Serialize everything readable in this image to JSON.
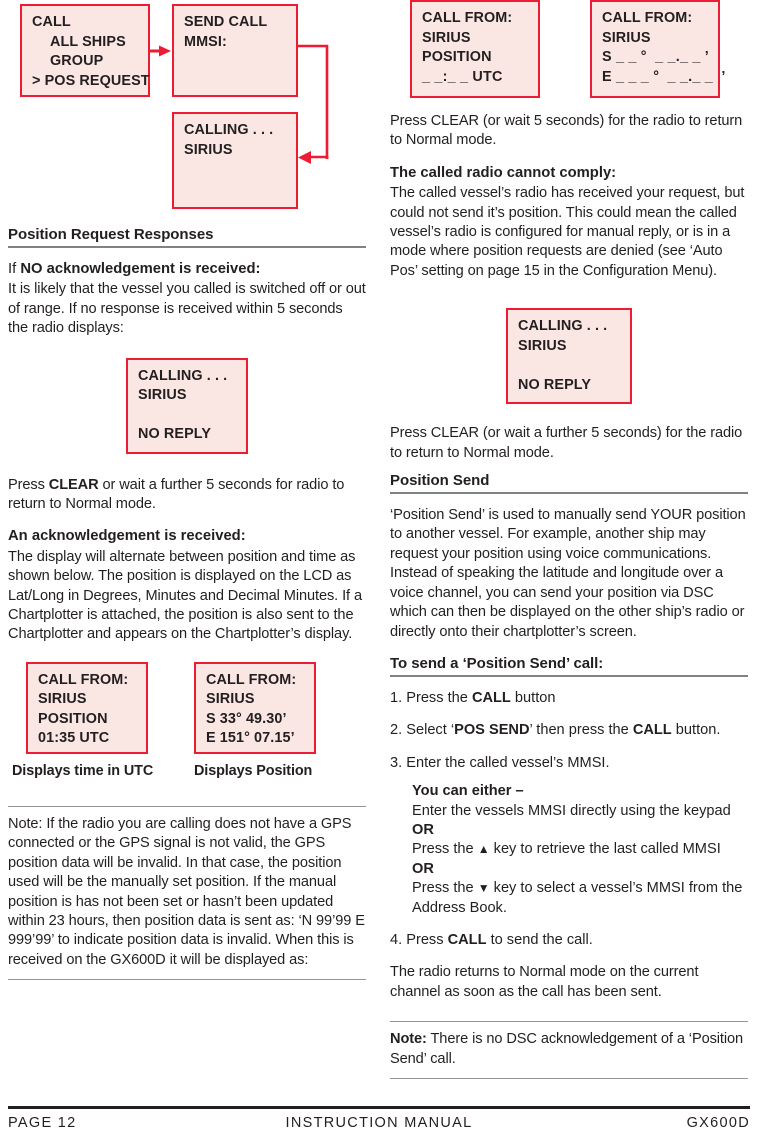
{
  "colors": {
    "lcd_fill": "#fae7e3",
    "lcd_border": "#ed1c33",
    "rule_grey": "#939598",
    "section_rule": "#808285",
    "text": "#231f20"
  },
  "diagram": {
    "box_call": {
      "line1": "CALL",
      "line2": "ALL SHIPS",
      "line3": "GROUP",
      "line4": "> POS REQUEST"
    },
    "box_send_call": {
      "line1": "SEND CALL",
      "line2": "MMSI:"
    },
    "box_calling": {
      "line1": "CALLING . . .",
      "line2": "SIRIUS"
    }
  },
  "left": {
    "section_title": "Position Request Responses",
    "no_ack_heading_prefix": "If ",
    "no_ack_heading_bold": "NO acknowledgement is received:",
    "no_ack_body": "It is likely that the vessel you called is switched off or out of range. If no response is received within 5 seconds the radio displays:",
    "lcd_no_reply": {
      "line1": "CALLING . . .",
      "line2": "SIRIUS",
      "line3": "",
      "line4": "NO REPLY"
    },
    "press_clear_1": "Press ",
    "press_clear_1_bold": "CLEAR",
    "press_clear_1_rest": " or wait a further 5 seconds for radio to return to Normal mode.",
    "ack_heading": "An acknowledgement is received:",
    "ack_body": "The display will alternate between position and time as shown below. The position is displayed on the LCD as Lat/Long in Degrees, Minutes and Decimal Minutes. If a Chartplotter is attached, the position is also sent to the Chartplotter and appears on the Chartplotter’s display.",
    "lcd_time": {
      "line1": "CALL FROM:",
      "line2": "SIRIUS",
      "line3": "POSITION",
      "line4": "01:35 UTC"
    },
    "lcd_position": {
      "line1": "CALL FROM:",
      "line2": "SIRIUS",
      "line3": "S 33° 49.30’",
      "line4": "E 151° 07.15’"
    },
    "caption_time": "Displays time in UTC",
    "caption_position": "Displays Position",
    "note_body": "Note: If the radio you are calling does not have a GPS connected or the GPS signal is not valid, the GPS position data will be invalid. In that case, the position used will be the manually set position. If the manual position is has not been set or hasn’t been updated within 23 hours, then position data is sent as: ‘N 99’99 E 999’99’ to indicate position data is invalid. When this is received on the GX600D it will be displayed as:"
  },
  "right": {
    "lcd_time_blank": {
      "line1": "CALL FROM:",
      "line2": "SIRIUS",
      "line3": "POSITION",
      "line4": "_ _:_ _ UTC"
    },
    "lcd_position_blank": {
      "line1": "CALL FROM:",
      "line2": "SIRIUS",
      "line3": "S _ _ °  _ _._ _ ’",
      "line4": "E _ _ _ °  _ _._ _  ’"
    },
    "press_clear_2": "Press CLEAR (or wait 5 seconds) for the radio to return to Normal mode.",
    "cannot_comply_heading": "The called radio cannot comply:",
    "cannot_comply_body": "The called vessel’s radio has received your request, but could not send it’s position. This could mean the called vessel’s radio is configured for manual reply, or is in a mode where position requests are denied (see ‘Auto Pos’ setting on page 15 in the Configuration Menu).",
    "lcd_no_reply": {
      "line1": "CALLING . . .",
      "line2": "SIRIUS",
      "line3": "",
      "line4": "NO REPLY"
    },
    "press_clear_3": "Press CLEAR (or wait a further 5 seconds) for the radio to return to Normal mode.",
    "position_send_title": "Position Send",
    "position_send_body": "‘Position Send’ is used to manually send YOUR position to another vessel. For example, another ship may request your position using voice communications. Instead of speaking the latitude and longitude over a voice channel, you can send your position via DSC which can then be displayed on the other ship’s radio or directly onto their chartplotter’s screen.",
    "to_send_title": "To send a ‘Position Send’ call:",
    "steps": {
      "s1_pre": "1. Press the ",
      "s1_bold": "CALL",
      "s1_post": " button",
      "s2_pre": "2. Select ‘",
      "s2_bold": "POS SEND",
      "s2_mid": "’ then press the ",
      "s2_bold2": "CALL",
      "s2_post": " button.",
      "s3": "3. Enter the called vessel’s MMSI.",
      "sub_heading": "You can either –",
      "sub_line1": "Enter the vessels MMSI directly using the keypad",
      "sub_or1": "OR",
      "sub_line2_pre": "Press the ",
      "sub_line2_icon": "▲",
      "sub_line2_post": " key to retrieve the last called MMSI",
      "sub_or2": "OR",
      "sub_line3_pre": "Press the ",
      "sub_line3_icon": "▼",
      "sub_line3_post": " key to select a vessel’s MMSI from the Address Book.",
      "s4_pre": "4. Press ",
      "s4_bold": "CALL",
      "s4_post": " to send the call."
    },
    "after_send_body": "The radio returns to Normal mode on the current channel as soon as the call has been sent.",
    "note_bold": "Note:",
    "note_rest": " There is no DSC acknowledgement of a ‘Position Send’ call."
  },
  "footer": {
    "page": "PAGE 12",
    "center": "INSTRUCTION MANUAL",
    "model": "GX600D"
  }
}
